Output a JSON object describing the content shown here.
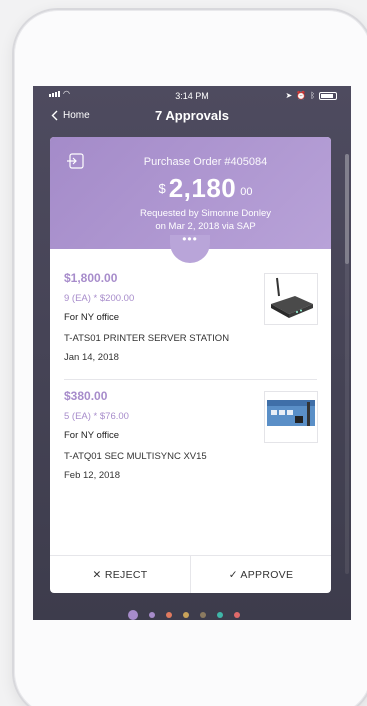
{
  "status_bar": {
    "time": "3:14 PM"
  },
  "nav": {
    "back_label": "Home",
    "title": "7 Approvals"
  },
  "order": {
    "title": "Purchase Order #405084",
    "currency": "$",
    "amount_main": "2,180",
    "amount_cents": "00",
    "requested_line1": "Requested by Simonne Donley",
    "requested_line2": "on Mar 2, 2018 via SAP",
    "more_label": "•••"
  },
  "items": [
    {
      "price": "$1,800.00",
      "qty": "9 (EA) * $200.00",
      "note": "For NY office",
      "sku": "T-ATS01 PRINTER SERVER STATION",
      "date": "Jan 14, 2018"
    },
    {
      "price": "$380.00",
      "qty": "5 (EA) * $76.00",
      "note": "For NY office",
      "sku": "T-ATQ01 SEC MULTISYNC XV15",
      "date": "Feb 12, 2018"
    }
  ],
  "actions": {
    "reject_label": "✕ REJECT",
    "approve_label": "✓ APPROVE"
  },
  "colors": {
    "accent": "#a78ccb",
    "header": "#a48bc9",
    "screen_bg": "#46445a",
    "dots": [
      "#a78ccb",
      "#a78ccb",
      "#e07a5f",
      "#c9a35a",
      "#8b7a60",
      "#3fb6a8",
      "#e06a6a"
    ]
  },
  "pagination": {
    "count": 7,
    "active_index": 0
  }
}
